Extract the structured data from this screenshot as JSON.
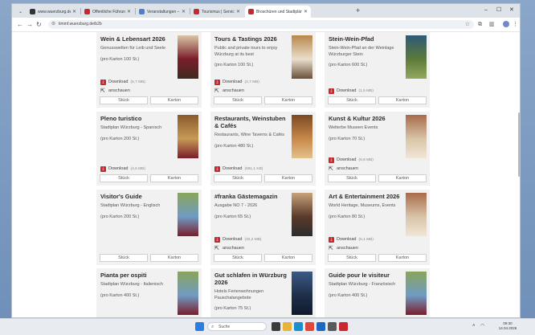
{
  "browser": {
    "tabs": [
      {
        "label": "www.wuerzburg.de - Content",
        "favicon_color": "#333333",
        "active": false
      },
      {
        "label": "Öffentliche Führungen – Öffentl",
        "favicon_color": "#c8272e",
        "active": false
      },
      {
        "label": "Veranstaltungen – Google Suche",
        "favicon_color": "#4a7fd6",
        "active": false
      },
      {
        "label": "Tourismus | Service | Broschüre",
        "favicon_color": "#c8272e",
        "active": false
      },
      {
        "label": "Broschüren und Stadtpläne",
        "favicon_color": "#c8272e",
        "active": true
      }
    ],
    "new_tab": "+",
    "url": "timmf.wuerzburg.de/b2b",
    "window_controls": {
      "minimize": "–",
      "maximize": "☐",
      "close": "✕"
    }
  },
  "brochures": [
    {
      "title": "Wein & Lebensart 2026",
      "subtitle": "Genusswelten für Leib und Seele",
      "pack": "(pro Karton 100 St.)",
      "download": "Download",
      "size": "(5,7 MB)",
      "view": "anschauen",
      "btn_piece": "Stück",
      "btn_box": "Karton",
      "thumb": [
        "#7a1d2a",
        "#d9c6a6",
        "#3e2a20"
      ]
    },
    {
      "title": "Tours & Tastings 2026",
      "subtitle": "Public and private tours to enjoy Würzburg at its best",
      "pack": "(pro Karton 100 St.)",
      "download": "Download",
      "size": "(4,7 MB)",
      "view": "anschauen",
      "btn_piece": "Stück",
      "btn_box": "Karton",
      "thumb": [
        "#e9dfcc",
        "#b8874a",
        "#6b4f3a"
      ]
    },
    {
      "title": "Stein-Wein-Pfad",
      "subtitle": "Stein-Wein-Pfad an der Weinlage Würzburger Stein",
      "pack": "(pro Karton 600 St.)",
      "download": "Download",
      "size": "(1,5 MB)",
      "view": "",
      "btn_piece": "Stück",
      "btn_box": "Karton",
      "thumb": [
        "#5d7a3a",
        "#2f5876",
        "#93a961"
      ]
    },
    {
      "title": "Pleno turistico",
      "subtitle": "Stadtplan Würzburg - Spanisch",
      "pack": "(pro Karton 200 St.)",
      "download": "Download",
      "size": "(4,6 MB)",
      "view": "",
      "btn_piece": "Stück",
      "btn_box": "Karton",
      "thumb": [
        "#c79a55",
        "#8a5a2c",
        "#7a1d2a"
      ]
    },
    {
      "title": "Restaurants, Weinstuben & Cafés",
      "subtitle": "Restaurants, Wine Taverns & Cafés",
      "pack": "(pro Karton 480 St.)",
      "download": "Download",
      "size": "(691,1 KB)",
      "view": "",
      "btn_piece": "Stück",
      "btn_box": "Karton",
      "thumb": [
        "#c9884a",
        "#7a4a22",
        "#e3c08a"
      ]
    },
    {
      "title": "Kunst & Kultur 2026",
      "subtitle": "Welterbe Museen Events",
      "pack": "(pro Karton 70 St.)",
      "download": "Download",
      "size": "(6,6 MB)",
      "view": "anschauen",
      "btn_piece": "Stück",
      "btn_box": "Karton",
      "thumb": [
        "#d8c4a8",
        "#a86b4a",
        "#f0e6d6"
      ]
    },
    {
      "title": "Visitor's Guide",
      "subtitle": "Stadtplan Würzburg - Englisch",
      "pack": "(pro Karton 200 St.)",
      "download": "",
      "size": "",
      "view": "",
      "btn_piece": "Stück",
      "btn_box": "Karton",
      "thumb": [
        "#6f9bc4",
        "#8aa55a",
        "#7a1d2a"
      ]
    },
    {
      "title": "#franka Gästemagazin",
      "subtitle": "Ausgabe NO 7 - 2026",
      "pack": "(pro Karton 65 St.)",
      "download": "Download",
      "size": "(32,2 MB)",
      "view": "anschauen",
      "btn_piece": "Stück",
      "btn_box": "Karton",
      "thumb": [
        "#5a3a2a",
        "#c7a27a",
        "#2d2d2d"
      ]
    },
    {
      "title": "Art & Entertainment 2026",
      "subtitle": "World Heritage, Museums, Events",
      "pack": "(pro Karton 80 St.)",
      "download": "Download",
      "size": "(5,1 MB)",
      "view": "anschauen",
      "btn_piece": "Stück",
      "btn_box": "Karton",
      "thumb": [
        "#d8c4a8",
        "#a86b4a",
        "#f0e6d6"
      ]
    },
    {
      "title": "Pianta per ospiti",
      "subtitle": "Stadtplan Würzburg - Italienisch",
      "pack": "(pro Karton 400 St.)",
      "download": "",
      "size": "",
      "view": "",
      "btn_piece": "",
      "btn_box": "",
      "thumb": [
        "#6f9bc4",
        "#8aa55a",
        "#7a1d2a"
      ]
    },
    {
      "title": "Gut schlafen in Würzburg 2026",
      "subtitle": "Hotels Ferienwohnungen Pauschalangebote",
      "pack": "(pro Karton 75 St.)",
      "download": "",
      "size": "",
      "view": "",
      "btn_piece": "",
      "btn_box": "",
      "thumb": [
        "#1f2f4a",
        "#3b5a85",
        "#0e1a2c"
      ]
    },
    {
      "title": "Guide pour le visiteur",
      "subtitle": "Stadtplan Würzburg - Französisch",
      "pack": "(pro Karton 400 St.)",
      "download": "",
      "size": "",
      "view": "",
      "btn_piece": "",
      "btn_box": "",
      "thumb": [
        "#6f9bc4",
        "#8aa55a",
        "#7a1d2a"
      ]
    }
  ],
  "taskbar": {
    "search_label": "Suche",
    "time": "09:30",
    "date": "14.04.2026",
    "apps": [
      {
        "name": "windows-start-icon",
        "color": "#2b7de0"
      },
      {
        "name": "task-view-icon",
        "color": "#3b3b3b"
      },
      {
        "name": "file-explorer-icon",
        "color": "#e8b339"
      },
      {
        "name": "edge-icon",
        "color": "#1b8fc9"
      },
      {
        "name": "chrome-icon",
        "color": "#e0463a"
      },
      {
        "name": "outlook-icon",
        "color": "#1d67c3"
      },
      {
        "name": "settings-icon",
        "color": "#5a5a5a"
      },
      {
        "name": "acrobat-icon",
        "color": "#c8272e"
      }
    ]
  }
}
